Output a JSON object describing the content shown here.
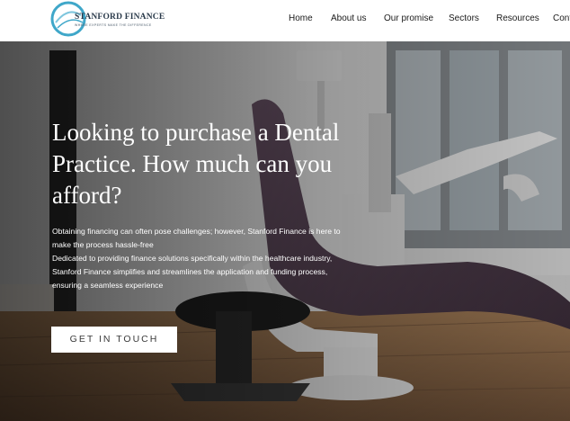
{
  "header": {
    "logo": {
      "name": "STANFORD FINANCE",
      "tagline": "WHERE EXPERTS MAKE THE DIFFERENCE"
    },
    "nav": [
      {
        "label": "Home"
      },
      {
        "label": "About us"
      },
      {
        "label": "Our promise"
      },
      {
        "label": "Sectors"
      },
      {
        "label": "Resources"
      },
      {
        "label": "Cont"
      }
    ]
  },
  "hero": {
    "headline": "Looking to purchase a Dental Practice. How much can you afford?",
    "paragraph_1": "Obtaining financing can often pose challenges; however, Stanford Finance is here to make the process hassle-free",
    "paragraph_2": "Dedicated to providing finance solutions specifically within the healthcare industry, Stanford Finance simplifies and streamlines the application and funding process, ensuring a seamless experience",
    "cta_label": "GET IN TOUCH"
  },
  "colors": {
    "logo_accent": "#3fa7c9",
    "chair_upholstery": "#5a4658",
    "overlay": "#000000"
  }
}
